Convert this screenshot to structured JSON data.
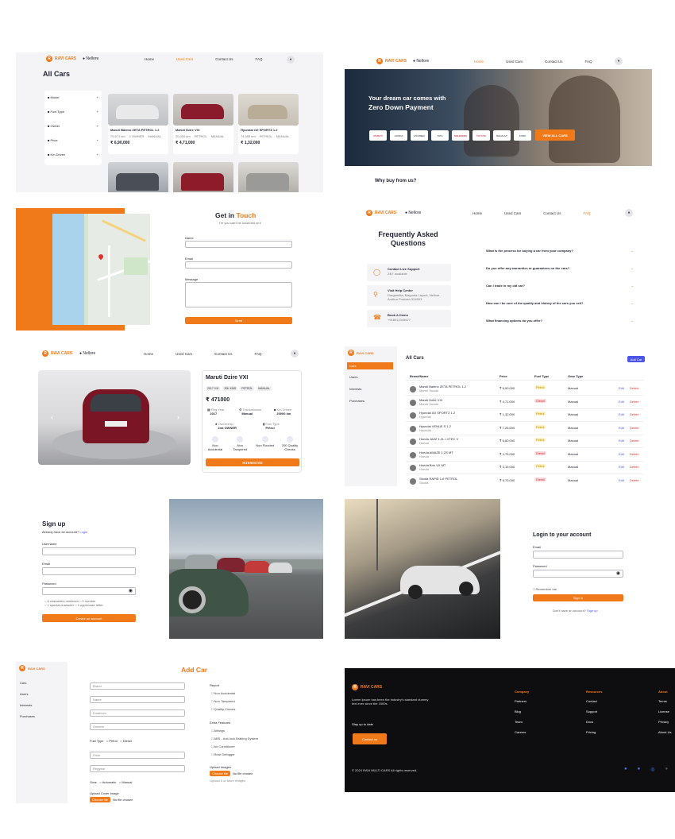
{
  "brand": {
    "name": "RAVI CARS",
    "letter": "R",
    "location": "Nellore"
  },
  "nav": [
    "Home",
    "Used Cars",
    "Contact Us",
    "FAQ"
  ],
  "panel1": {
    "title": "All Cars",
    "filters": [
      "Model",
      "Fuel Type",
      "Owner",
      "Price",
      "Km Driven"
    ],
    "cars": [
      {
        "name": "Maruti Baleno ZETA PETROL 1.2",
        "meta": [
          "75,671 km",
          "1 OWNER",
          "MANUAL"
        ],
        "price": "₹ 6,90,000"
      },
      {
        "name": "Maruti Dzire VXI",
        "meta": [
          "20,000 km",
          "PETROL",
          "MANUAL"
        ],
        "price": "₹ 4,71,000"
      },
      {
        "name": "Hyundai i10 SPORTZ 1.2",
        "meta": [
          "74,959 km",
          "PETROL",
          "MANUAL"
        ],
        "price": "₹ 1,32,000"
      }
    ]
  },
  "panel2": {
    "hero_line1": "Your dream car comes with",
    "hero_line2": "Zero Down Payment",
    "brands": [
      "MARUTI",
      "HONDA",
      "HYUNDAI",
      "TATA",
      "MAHINDRA",
      "TOYOTA",
      "RENAULT",
      "FORD"
    ],
    "view_all": "VIEW ALL CARS",
    "why": "Why buy from us?"
  },
  "panel3": {
    "title_a": "Get in",
    "title_b": "Touch",
    "subtitle": "I'm you can't be loosened at it",
    "fields": [
      "Name",
      "Email",
      "Message"
    ],
    "send": "Send"
  },
  "panel4": {
    "title": "Frequently Asked Questions",
    "cards": [
      {
        "title": "Contact Live Support",
        "sub": "24/7 available"
      },
      {
        "title": "Visit Help Center",
        "sub": "Dargamitta, Magunta Layout, Nellore, Andhra Pradesh 524003"
      },
      {
        "title": "Book A Demo",
        "sub": "+918012345677"
      }
    ],
    "questions": [
      "What is the process for buying a car from your company?",
      "Do you offer any warranties or guarantees on the cars?",
      "Can I trade in my old car?",
      "How can I be sure of the quality and history of the cars you sell?",
      "What financing options do you offer?"
    ]
  },
  "panel5": {
    "car_name": "Maruti Dzire VXI",
    "tags": [
      "2017 VXI",
      "20K KMS",
      "PETROL",
      "MANUAL"
    ],
    "price": "₹ 471000",
    "specs": [
      {
        "label": "Reg Year",
        "value": "2017"
      },
      {
        "label": "Transmission",
        "value": "Manual"
      },
      {
        "label": "Km Driven",
        "value": "20000 km"
      },
      {
        "label": "Ownership",
        "value": "2nd OWNER"
      },
      {
        "label": "Fuel Type",
        "value": "Petrol"
      }
    ],
    "features": [
      "Non Accidental",
      "Non Tampered",
      "Non Flooded",
      "200 Quality Checks"
    ],
    "interested": "INTERESTED"
  },
  "panel6": {
    "sidebar": [
      "Cars",
      "Users",
      "Interests",
      "Purchases"
    ],
    "title": "All Cars",
    "add": "Add Car",
    "headers": [
      "Brand/Name",
      "Price",
      "Fuel Type",
      "Gear Type"
    ],
    "rows": [
      {
        "name": "Maruti Baleno ZETA PETROL 1.2",
        "brand": "Maruti Suzuki",
        "price": "₹ 6,90,000",
        "fuel": "Petrol",
        "gear": "Manual"
      },
      {
        "name": "Maruti Dzire VXI",
        "brand": "Maruti Suzuki",
        "price": "₹ 4,71,000",
        "fuel": "Diesel",
        "gear": "Manual"
      },
      {
        "name": "Hyundai i10 SPORTZ 1.2",
        "brand": "Hyundai",
        "price": "₹ 1,32,000",
        "fuel": "Petrol",
        "gear": "Manual"
      },
      {
        "name": "Hyundai VENUE S 1.2",
        "brand": "Hyundai",
        "price": "₹ 7,26,000",
        "fuel": "Petrol",
        "gear": "Manual"
      },
      {
        "name": "Honda JAZZ 1.2L I-VTEC V",
        "brand": "Honda",
        "price": "₹ 6,60,000",
        "fuel": "Petrol",
        "gear": "Manual"
      },
      {
        "name": "Honda AMAZE 1.2S MT",
        "brand": "Honda",
        "price": "₹ 4,75,000",
        "fuel": "Diesel",
        "gear": "Manual"
      },
      {
        "name": "Honda Brio VX MT",
        "brand": "Honda",
        "price": "₹ 3,15,000",
        "fuel": "Petrol",
        "gear": "Manual"
      },
      {
        "name": "Skoda RAPID 1.6 PETROL",
        "brand": "Skoda",
        "price": "₹ 5,70,000",
        "fuel": "Diesel",
        "gear": "Manual"
      }
    ],
    "edit": "Edit",
    "delete": "Delete"
  },
  "panel7": {
    "title": "Sign up",
    "have_account": "Already have an account?",
    "login": "Login",
    "fields": [
      "Username",
      "Email",
      "Password"
    ],
    "rules": [
      "8 characters minimum",
      "1 number",
      "1 special character",
      "1 uppercase letter"
    ],
    "create": "Create an account"
  },
  "panel8": {
    "title": "Login to your account",
    "fields": [
      "Email",
      "Password"
    ],
    "remember": "Remember me",
    "sign_in": "Sign in",
    "no_account": "Don't have an account?",
    "sign_up": "Sign up"
  },
  "panel9": {
    "sidebar": [
      "Cars",
      "Users",
      "Interests",
      "Purchases"
    ],
    "title": "Add Car",
    "inputs": [
      "Brand",
      "Name",
      "Kmdriven",
      "Owners"
    ],
    "fuel_label": "Fuel Type",
    "fuel_opts": [
      "Petrol",
      "Diesel"
    ],
    "inputs2": [
      "Price",
      "Regyear"
    ],
    "gear_label": "Gear",
    "gear_opts": [
      "Automatic",
      "Manual"
    ],
    "upload_cover": "Upload Cover Image",
    "choose": "Choose file",
    "no_file": "No file chosen",
    "report_label": "Report",
    "report": [
      "Non Accidental",
      "Non Tampered",
      "Quality Checks"
    ],
    "extra_label": "Extra Features",
    "extra": [
      "Airbags",
      "ABS - Anti-lock Braking System",
      "Air Conditioner",
      "Rear Defogger"
    ],
    "upload_images": "Upload Images",
    "upload_more": "Upload 5 or More Images"
  },
  "footer": {
    "brand": "RAVI CARS",
    "desc": "Lorem Ipsum has been the industry's standard dummy text ever since the 1500s.",
    "stay": "Stay up to date",
    "contact_btn": "Contact us",
    "copyright": "© 2024 RAVI MULTI CARS All rights reserved.",
    "columns": [
      {
        "head": "Company",
        "items": [
          "Partners",
          "Blog",
          "Team",
          "Careers"
        ]
      },
      {
        "head": "Resources",
        "items": [
          "Contact",
          "Support",
          "Docs",
          "Pricing"
        ]
      },
      {
        "head": "About",
        "items": [
          "Terms",
          "License",
          "Privacy",
          "About Us"
        ]
      }
    ]
  },
  "colors": {
    "accent": "#f07a1a",
    "dark": "#0e0e10",
    "panel_bg": "#f4f4f6"
  }
}
